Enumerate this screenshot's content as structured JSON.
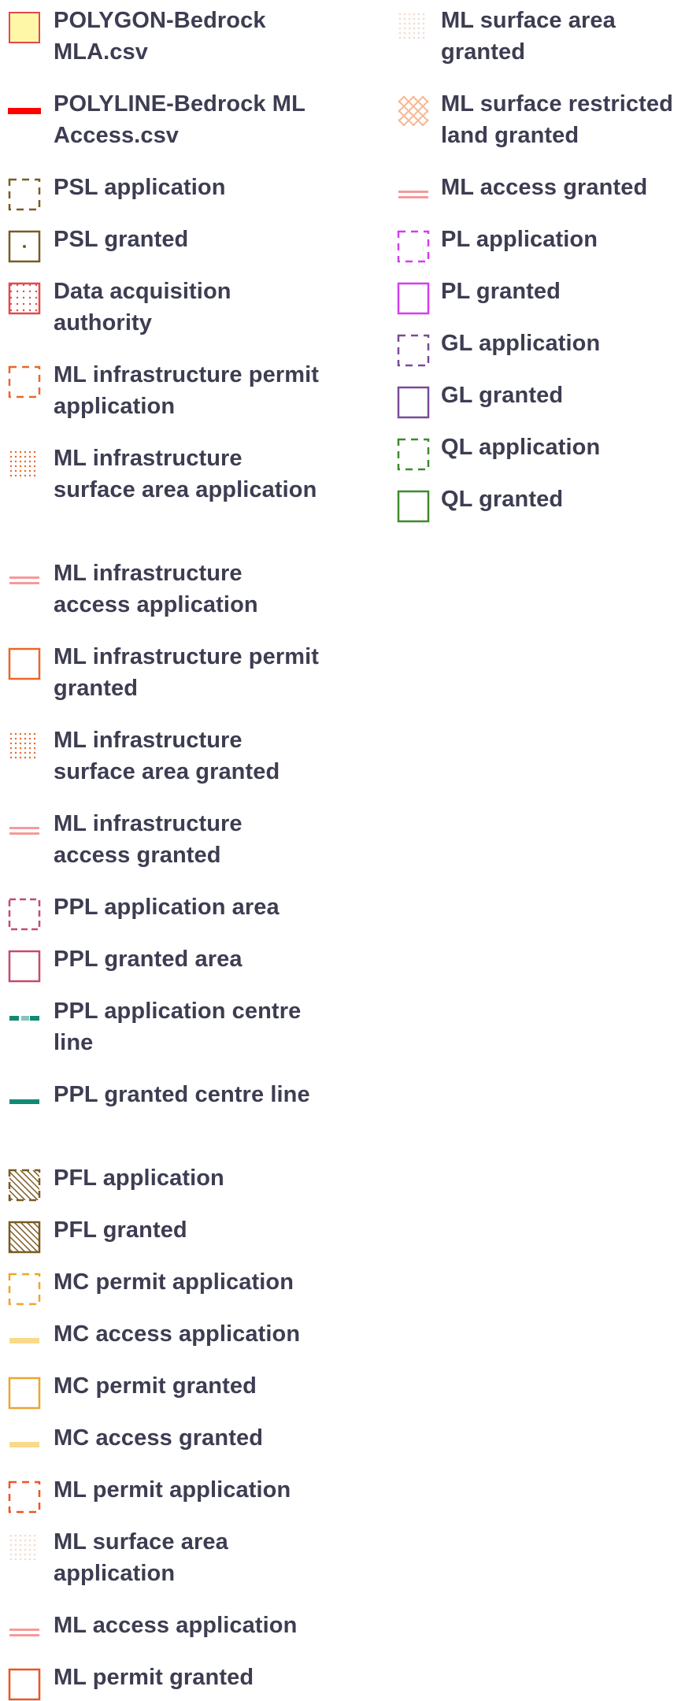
{
  "legend": {
    "left": [
      {
        "label": "POLYGON-Bedrock MLA.csv",
        "symbol": "poly-yellow-fill"
      },
      {
        "label": "POLYLINE-Bedrock ML Access.csv",
        "symbol": "line-red"
      },
      {
        "label": "PSL application",
        "symbol": "dash-brown"
      },
      {
        "label": "PSL granted",
        "symbol": "solid-brown-dot"
      },
      {
        "label": "Data acquisition authority",
        "symbol": "dots-red"
      },
      {
        "label": "ML infrastructure permit application",
        "symbol": "dash-orange"
      },
      {
        "label": "ML infrastructure surface area application",
        "symbol": "dots-orange"
      },
      {
        "label": "ML infrastructure access application",
        "symbol": "line-pink-double"
      },
      {
        "label": "ML infrastructure permit granted",
        "symbol": "solid-orange"
      },
      {
        "label": "ML infrastructure surface area granted",
        "symbol": "dots-orange"
      },
      {
        "label": "ML infrastructure access granted",
        "symbol": "line-pink-double"
      },
      {
        "label": "PPL application area",
        "symbol": "dash-rose"
      },
      {
        "label": "PPL granted area",
        "symbol": "solid-rose"
      },
      {
        "label": "PPL application centre line",
        "symbol": "line-teal-dash"
      },
      {
        "label": "PPL granted centre line",
        "symbol": "line-teal"
      },
      {
        "label": "PFL application",
        "symbol": "hatch-brown-dash"
      },
      {
        "label": "PFL granted",
        "symbol": "hatch-brown"
      },
      {
        "label": "MC permit application",
        "symbol": "dash-amber"
      },
      {
        "label": "MC access application",
        "symbol": "line-amber"
      },
      {
        "label": "MC permit granted",
        "symbol": "solid-amber"
      },
      {
        "label": "MC access granted",
        "symbol": "line-amber"
      },
      {
        "label": "ML permit application",
        "symbol": "dash-orange-red"
      },
      {
        "label": "ML surface area application",
        "symbol": "dots-faint"
      },
      {
        "label": "ML access application",
        "symbol": "line-pink-double"
      },
      {
        "label": "ML permit granted",
        "symbol": "solid-orange-red"
      }
    ],
    "right": [
      {
        "label": "ML surface area granted",
        "symbol": "dots-faint"
      },
      {
        "label": "ML surface restricted land granted",
        "symbol": "crosshatch-peach"
      },
      {
        "label": "ML access granted",
        "symbol": "line-pink-double"
      },
      {
        "label": "PL application",
        "symbol": "dash-magenta"
      },
      {
        "label": "PL granted",
        "symbol": "solid-magenta"
      },
      {
        "label": "GL application",
        "symbol": "dash-purple"
      },
      {
        "label": "GL granted",
        "symbol": "solid-purple"
      },
      {
        "label": "QL application",
        "symbol": "dash-green"
      },
      {
        "label": "QL granted",
        "symbol": "solid-green"
      }
    ]
  },
  "colors": {
    "text": "#3d3d52",
    "yellow_fill": "#fff7a8",
    "red_line": "#ff0000",
    "brown": "#7a5a22",
    "red_dots": "#e04a4a",
    "orange": "#e8682a",
    "pink_line": "#f59a9a",
    "rose": "#c64b6b",
    "teal": "#138a74",
    "amber": "#eda52e",
    "light_amber": "#fad98a",
    "orange_red": "#ea5526",
    "faint": "#f1dcd0",
    "peach": "#f6b894",
    "magenta": "#d43cf0",
    "purple": "#7a4a9b",
    "green": "#3d8a2a"
  }
}
